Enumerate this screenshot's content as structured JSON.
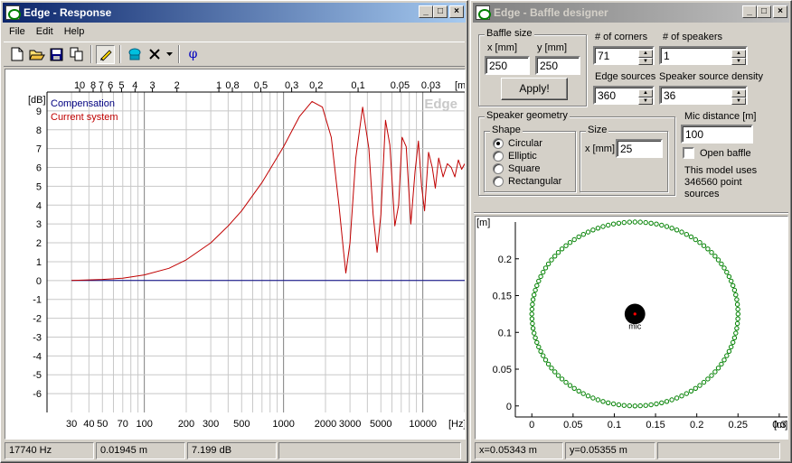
{
  "response_window": {
    "title": "Edge - Response",
    "menu": [
      "File",
      "Edit",
      "Help"
    ],
    "toolbar_icons": [
      "new-icon",
      "open-icon",
      "save-icon",
      "copy-icon",
      "pencil-icon",
      "speaker-icon",
      "delete-icon",
      "dropdown-icon",
      "phi-icon"
    ],
    "phi_label": "φ",
    "status": {
      "freq": "17740 Hz",
      "dist": "0.01945 m",
      "level": "7.199 dB"
    },
    "watermark": "Edge"
  },
  "designer_window": {
    "title": "Edge - Baffle designer",
    "baffle_size": {
      "label": "Baffle size",
      "x_label": "x [mm]",
      "y_label": "y [mm]",
      "x_value": "250",
      "y_value": "250",
      "apply_label": "Apply!"
    },
    "corners": {
      "label": "# of corners",
      "value": "71"
    },
    "speakers": {
      "label": "# of speakers",
      "value": "1"
    },
    "edge_sources": {
      "label": "Edge sources",
      "value": "360"
    },
    "speaker_density": {
      "label": "Speaker source density",
      "value": "36"
    },
    "geometry": {
      "label": "Speaker geometry",
      "shape_label": "Shape",
      "shapes": [
        "Circular",
        "Elliptic",
        "Square",
        "Rectangular"
      ],
      "selected": 0,
      "size_label": "Size",
      "size_x_label": "x [mm]",
      "size_value": "25"
    },
    "mic_distance": {
      "label": "Mic distance [m]",
      "value": "100"
    },
    "open_baffle_label": "Open baffle",
    "info_lines": [
      "This model uses",
      "346560 point",
      "sources"
    ],
    "status": {
      "x": "x=0.05343 m",
      "y": "y=0.05355 m"
    }
  },
  "chart_data": [
    {
      "type": "line",
      "x_scale": "log",
      "xlabel": "[Hz]",
      "ylabel": "[dB]",
      "top_axis_label": "[m]",
      "xlim": [
        20,
        20000
      ],
      "ylim": [
        -7,
        10
      ],
      "x_ticks": [
        30,
        40,
        50,
        70,
        100,
        200,
        300,
        500,
        1000,
        2000,
        3000,
        5000,
        10000
      ],
      "x_tick_labels": [
        "30",
        "40",
        "50",
        "70",
        "100",
        "200",
        "300",
        "500",
        "1000",
        "2000",
        "3000",
        "5000",
        "10000"
      ],
      "y_ticks": [
        -6,
        -5,
        -4,
        -3,
        -2,
        -1,
        0,
        1,
        2,
        3,
        4,
        5,
        6,
        7,
        8,
        9
      ],
      "y_tick_labels": [
        "-6",
        "-5",
        "-4",
        "-3",
        "-2",
        "-1",
        "0",
        "1",
        "2",
        "3",
        "4",
        "5",
        "6",
        "7",
        "8",
        "9"
      ],
      "top_ticks_m": [
        10,
        8,
        7,
        6,
        5,
        4,
        3,
        2,
        1,
        0.8,
        0.5,
        0.3,
        0.2,
        0.1,
        0.05,
        0.03
      ],
      "top_tick_labels": [
        "10",
        "8",
        "7",
        "6",
        "5",
        "4",
        "3",
        "2",
        "1",
        "0.8",
        "0.5",
        "0.3",
        "0.2",
        "0.1",
        "0.05",
        "0.03"
      ],
      "grid": true,
      "legend_position": "top-left",
      "series": [
        {
          "name": "Compensation",
          "color": "#000080",
          "x": [
            30,
            20000
          ],
          "y": [
            0,
            0
          ]
        },
        {
          "name": "Current system",
          "color": "#c00000",
          "x": [
            30,
            50,
            70,
            100,
            150,
            200,
            300,
            400,
            500,
            700,
            1000,
            1300,
            1600,
            1900,
            2200,
            2500,
            2700,
            2800,
            3000,
            3300,
            3700,
            4100,
            4400,
            4700,
            5000,
            5400,
            5800,
            6300,
            6700,
            7100,
            7600,
            8200,
            8800,
            9300,
            9800,
            10300,
            11000,
            11700,
            12300,
            13000,
            14000,
            15000,
            16000,
            17000,
            18000,
            19000,
            20000
          ],
          "y": [
            0,
            0.06,
            0.12,
            0.3,
            0.65,
            1.1,
            2.0,
            2.9,
            3.7,
            5.2,
            7.1,
            8.7,
            9.5,
            9.2,
            7.6,
            4.0,
            1.5,
            0.4,
            2.0,
            6.5,
            9.2,
            7.0,
            3.5,
            1.5,
            3.5,
            8.5,
            7.2,
            2.9,
            4.0,
            7.6,
            7.1,
            3.0,
            5.8,
            7.4,
            5.0,
            3.7,
            6.8,
            6.0,
            4.9,
            6.5,
            5.5,
            6.2,
            6.0,
            5.5,
            6.4,
            5.9,
            6.2
          ]
        }
      ]
    },
    {
      "type": "scatter",
      "xlabel": "[m]",
      "ylabel": "[m]",
      "xlim": [
        -0.02,
        0.31
      ],
      "ylim": [
        -0.015,
        0.25
      ],
      "x_ticks": [
        0,
        0.05,
        0.1,
        0.15,
        0.2,
        0.25,
        0.3
      ],
      "x_tick_labels": [
        "0",
        "0.05",
        "0.1",
        "0.15",
        "0.2",
        "0.25",
        "0.3"
      ],
      "y_ticks": [
        0,
        0.05,
        0.1,
        0.15,
        0.2
      ],
      "y_tick_labels": [
        "0",
        "0.05",
        "0.1",
        "0.15",
        "0.2"
      ],
      "baffle_edge": {
        "center": [
          0.125,
          0.125
        ],
        "radius": 0.125,
        "color": "#008000"
      },
      "speaker": {
        "center": [
          0.125,
          0.125
        ],
        "radius": 0.0125,
        "color": "#000000"
      },
      "mic_label": "mic",
      "mic_color": "#ff0000"
    }
  ]
}
